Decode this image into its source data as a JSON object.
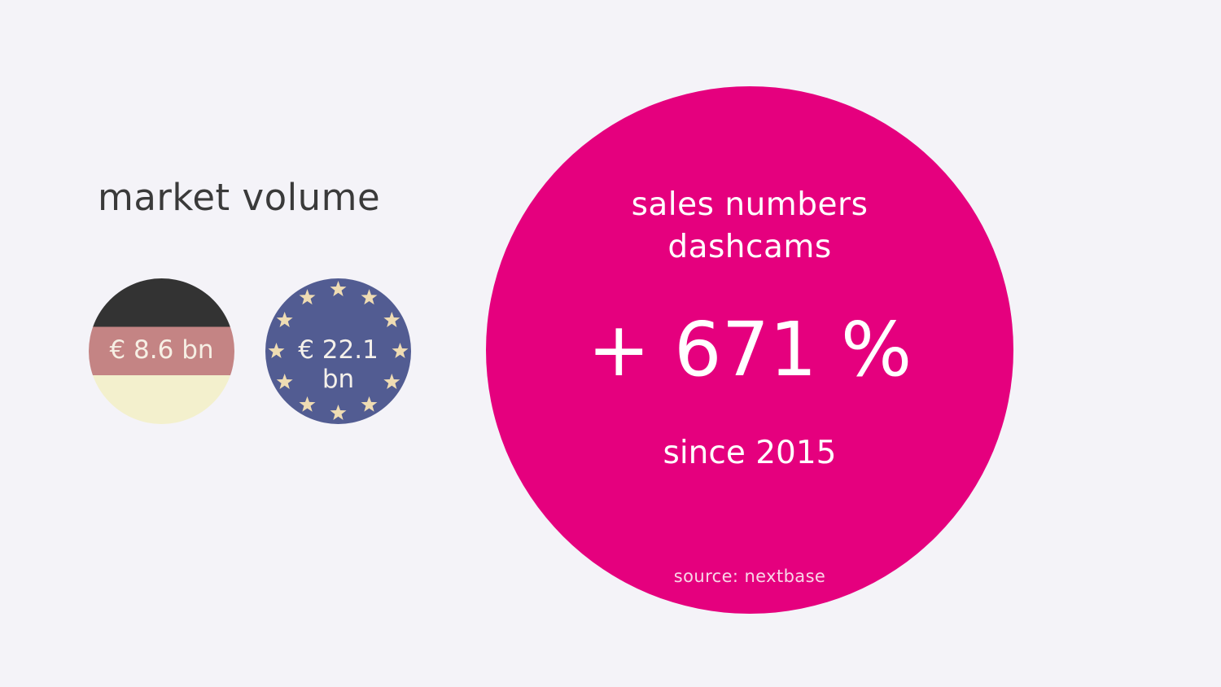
{
  "heading": "market volume",
  "badges": {
    "germany": {
      "value": "€ 8.6 bn",
      "colors": {
        "stripe_top": "#333333",
        "stripe_middle": "#c48484",
        "stripe_bottom": "#f3f0cd"
      }
    },
    "eu": {
      "value_line1": "€ 22.1",
      "value_line2": "bn",
      "colors": {
        "background": "#525c92",
        "stars": "#efdcb3"
      }
    }
  },
  "highlight": {
    "title_line1": "sales numbers",
    "title_line2": "dashcams",
    "stat": "+ 671 %",
    "since": "since 2015",
    "source": "source: nextbase",
    "color": "#e5007e"
  }
}
